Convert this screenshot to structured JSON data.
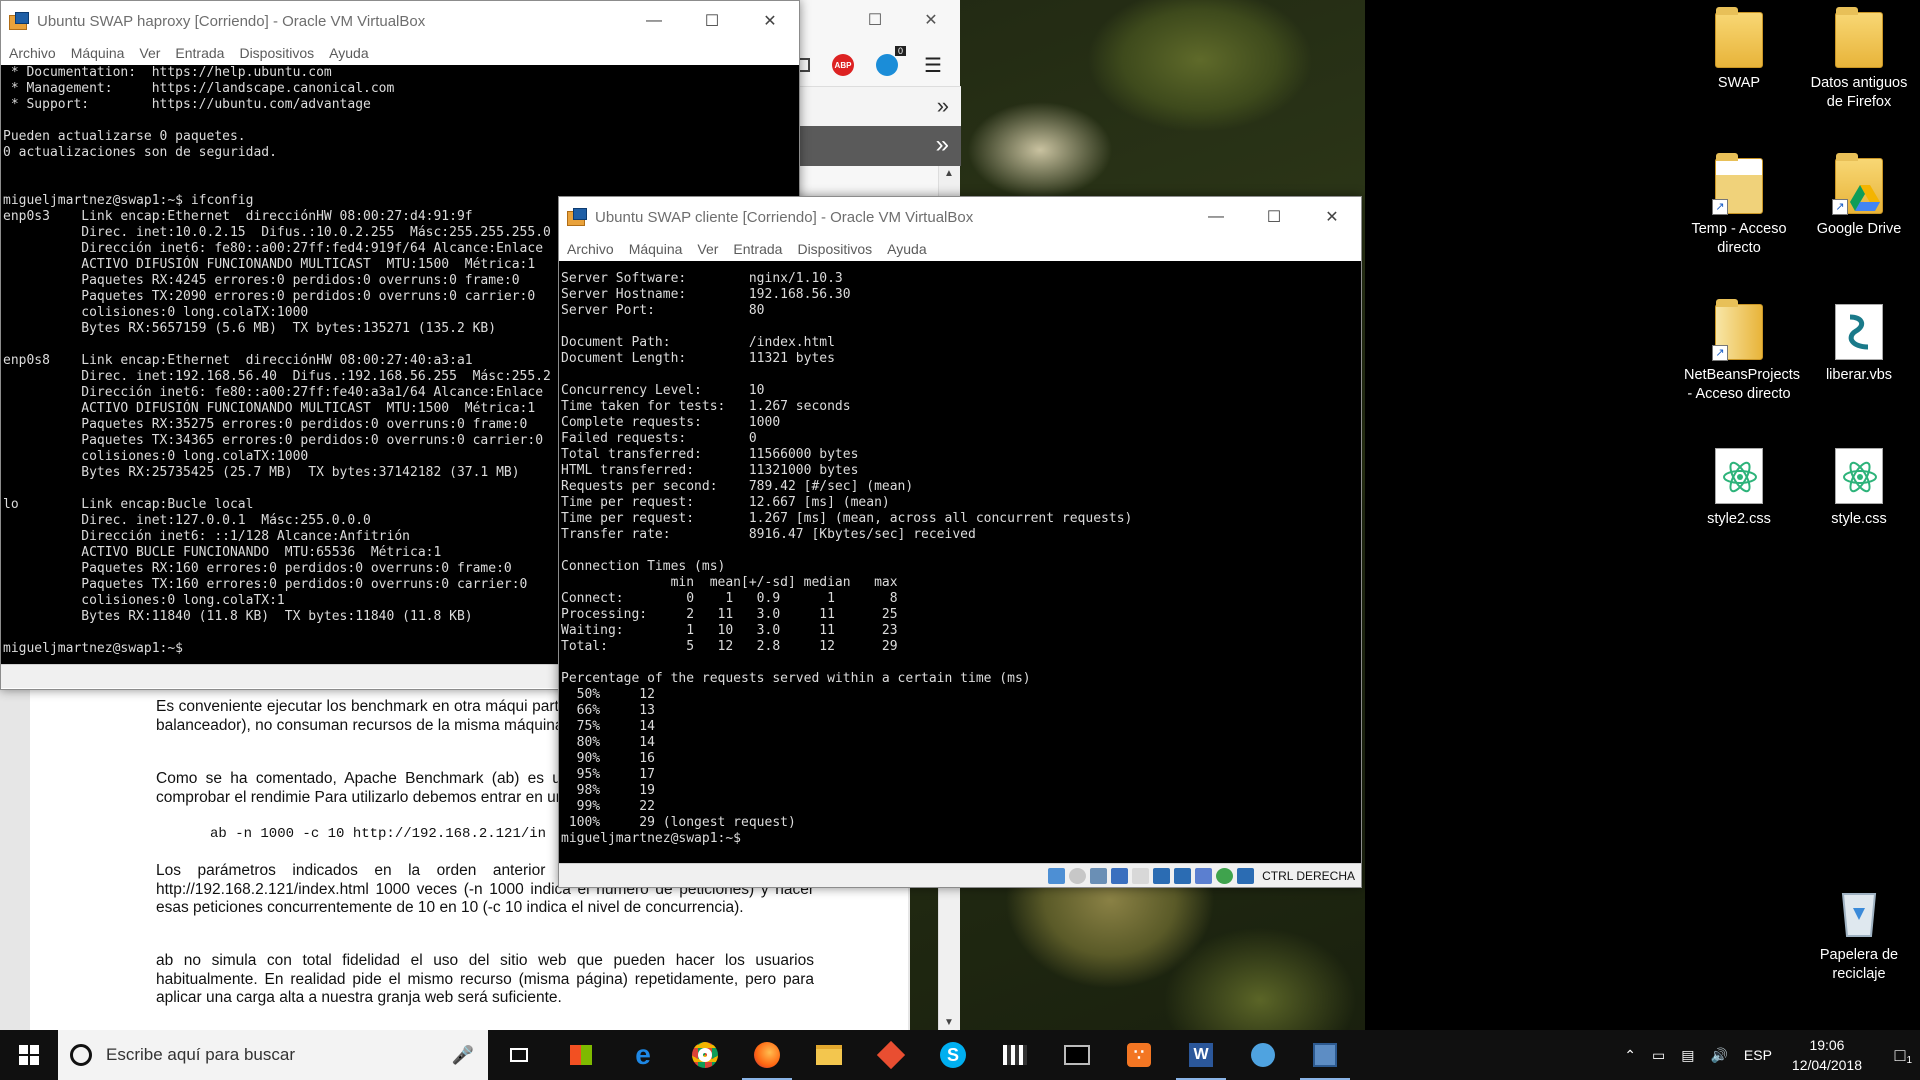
{
  "desktop": {
    "icons": [
      {
        "label": "SWAP",
        "kind": "folder"
      },
      {
        "label": "Datos antiguos de Firefox",
        "kind": "folder"
      },
      {
        "label": "Temp - Acceso directo",
        "kind": "folder-shortcut"
      },
      {
        "label": "Google Drive",
        "kind": "drive-shortcut"
      },
      {
        "label": "NetBeansProjects - Acceso directo",
        "kind": "folder-shortcut"
      },
      {
        "label": "liberar.vbs",
        "kind": "script-file"
      },
      {
        "label": "style2.css",
        "kind": "atom-file"
      },
      {
        "label": "style.css",
        "kind": "atom-file"
      },
      {
        "label": "Papelera de reciclaje",
        "kind": "recycle-bin"
      }
    ]
  },
  "vm_haproxy": {
    "title": "Ubuntu SWAP haproxy [Corriendo] - Oracle VM VirtualBox",
    "menu": [
      "Archivo",
      "Máquina",
      "Ver",
      "Entrada",
      "Dispositivos",
      "Ayuda"
    ],
    "terminal": " * Documentation:  https://help.ubuntu.com\n * Management:     https://landscape.canonical.com\n * Support:        https://ubuntu.com/advantage\n\nPueden actualizarse 0 paquetes.\n0 actualizaciones son de seguridad.\n\n\nmigueljmartnez@swap1:~$ ifconfig\nenp0s3    Link encap:Ethernet  direcciónHW 08:00:27:d4:91:9f\n          Direc. inet:10.0.2.15  Difus.:10.0.2.255  Másc:255.255.255.0\n          Dirección inet6: fe80::a00:27ff:fed4:919f/64 Alcance:Enlace\n          ACTIVO DIFUSIÓN FUNCIONANDO MULTICAST  MTU:1500  Métrica:1\n          Paquetes RX:4245 errores:0 perdidos:0 overruns:0 frame:0\n          Paquetes TX:2090 errores:0 perdidos:0 overruns:0 carrier:0\n          colisiones:0 long.colaTX:1000\n          Bytes RX:5657159 (5.6 MB)  TX bytes:135271 (135.2 KB)\n\nenp0s8    Link encap:Ethernet  direcciónHW 08:00:27:40:a3:a1\n          Direc. inet:192.168.56.40  Difus.:192.168.56.255  Másc:255.2\n          Dirección inet6: fe80::a00:27ff:fe40:a3a1/64 Alcance:Enlace\n          ACTIVO DIFUSIÓN FUNCIONANDO MULTICAST  MTU:1500  Métrica:1\n          Paquetes RX:35275 errores:0 perdidos:0 overruns:0 frame:0\n          Paquetes TX:34365 errores:0 perdidos:0 overruns:0 carrier:0\n          colisiones:0 long.colaTX:1000\n          Bytes RX:25735425 (25.7 MB)  TX bytes:37142182 (37.1 MB)\n\nlo        Link encap:Bucle local\n          Direc. inet:127.0.0.1  Másc:255.0.0.0\n          Dirección inet6: ::1/128 Alcance:Anfitrión\n          ACTIVO BUCLE FUNCIONANDO  MTU:65536  Métrica:1\n          Paquetes RX:160 errores:0 perdidos:0 overruns:0 frame:0\n          Paquetes TX:160 errores:0 perdidos:0 overruns:0 carrier:0\n          colisiones:0 long.colaTX:1\n          Bytes RX:11840 (11.8 KB)  TX bytes:11840 (11.8 KB)\n\nmigueljmartnez@swap1:~$"
  },
  "vm_cliente": {
    "title": "Ubuntu SWAP cliente [Corriendo] - Oracle VM VirtualBox",
    "menu": [
      "Archivo",
      "Máquina",
      "Ver",
      "Entrada",
      "Dispositivos",
      "Ayuda"
    ],
    "host_key": "CTRL DERECHA",
    "terminal": "Server Software:        nginx/1.10.3\nServer Hostname:        192.168.56.30\nServer Port:            80\n\nDocument Path:          /index.html\nDocument Length:        11321 bytes\n\nConcurrency Level:      10\nTime taken for tests:   1.267 seconds\nComplete requests:      1000\nFailed requests:        0\nTotal transferred:      11566000 bytes\nHTML transferred:       11321000 bytes\nRequests per second:    789.42 [#/sec] (mean)\nTime per request:       12.667 [ms] (mean)\nTime per request:       1.267 [ms] (mean, across all concurrent requests)\nTransfer rate:          8916.47 [Kbytes/sec] received\n\nConnection Times (ms)\n              min  mean[+/-sd] median   max\nConnect:        0    1   0.9      1       8\nProcessing:     2   11   3.0     11      25\nWaiting:        1   10   3.0     11      23\nTotal:          5   12   2.8     12      29\n\nPercentage of the requests served within a certain time (ms)\n  50%     12\n  66%     13\n  75%     14\n  80%     14\n  90%     16\n  95%     17\n  98%     19\n  99%     22\n 100%     29 (longest request)\nmigueljmartnez@swap1:~$"
  },
  "document": {
    "p1": "Es conveniente ejecutar los benchmark en otra máqui parte de la granja web (servidores web o balanceador), no consuman recursos de la misma máquina, ya que ve",
    "p2": "Como se ha comentado, Apache Benchmark (ab) es u con el servidor Apache y permite comprobar el rendimie Para utilizarlo debemos entrar en un terminal y ejecutar",
    "code": "ab -n 1000 -c 10 http://192.168.2.121/in",
    "p3": "Los parámetros indicados en la orden anterior le indica página con dirección http://192.168.2.121/index.html 1000 veces (-n 1000 indica el número de peticiones) y hacer esas peticiones concurrentemente de 10 en 10 (-c 10 indica el nivel de concurrencia).",
    "p4": "ab no simula con total fidelidad el uso del sitio web que pueden hacer los usuarios habitualmente. En realidad pide el mismo recurso (misma página) repetidamente, pero para aplicar una carga alta a nuestra granja web será suficiente."
  },
  "firefox": {
    "abp_label": "ABP",
    "badge_count": "0"
  },
  "taskbar": {
    "search_placeholder": "Escribe aquí para buscar",
    "language": "ESP",
    "time": "19:06",
    "date": "12/04/2018",
    "notification_count": "1"
  }
}
